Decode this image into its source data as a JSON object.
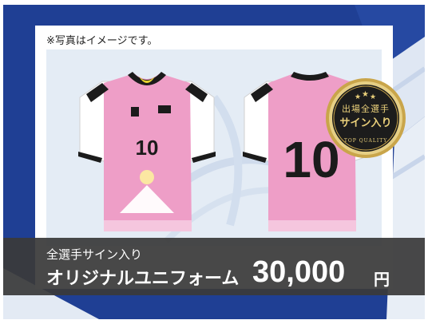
{
  "note": "※写真はイメージです。",
  "jersey": {
    "number": "10"
  },
  "seal": {
    "line1": "出場全選手",
    "line2": "サイン入り",
    "line3": "TOP QUALITY"
  },
  "price_band": {
    "subtitle": "全選手サイン入り",
    "title": "オリジナルユニフォーム",
    "price": "30,000",
    "currency": "円"
  },
  "colors": {
    "jersey_pink": "#ee9ec7",
    "navy": "#1f3f94",
    "gold": "#c9a54a"
  }
}
